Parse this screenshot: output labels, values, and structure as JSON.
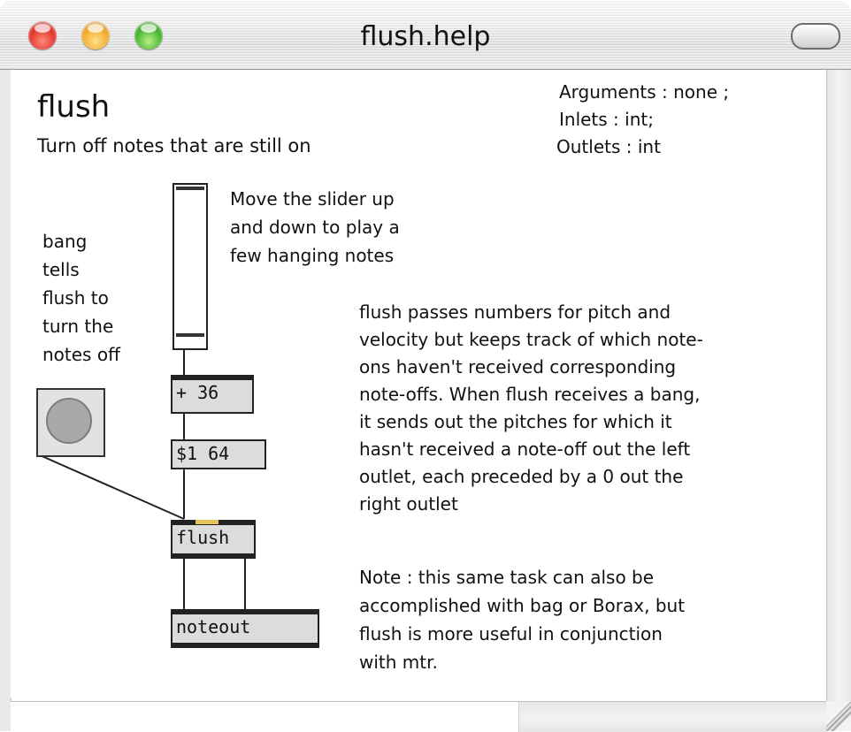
{
  "window": {
    "title": "flush.help"
  },
  "patch": {
    "title": "flush",
    "subtitle": "Turn off notes that are still on",
    "meta": {
      "arguments": "Arguments : none ;",
      "inlets": "Inlets : int;",
      "outlets": "Outlets : int"
    },
    "slider_comment": [
      "Move the slider up",
      "and down to play a",
      "few hanging notes"
    ],
    "bang_comment": [
      "bang",
      "tells",
      "flush to",
      "turn the",
      "notes off"
    ],
    "description": [
      "flush passes numbers for pitch and",
      "velocity but keeps track of which note-",
      "ons haven't received corresponding",
      "note-offs. When flush receives a bang,",
      "it sends out the pitches for which it",
      "hasn't received a note-off out the left",
      "outlet, each preceded by a 0 out the",
      "right outlet"
    ],
    "note": [
      "Note : this same task can also be",
      "accomplished with bag or Borax, but",
      "flush is more useful in conjunction",
      "with mtr."
    ],
    "objects": {
      "add": "+ 36",
      "message": "$1 64",
      "flush": "flush",
      "noteout": "noteout"
    },
    "slider_value": 0.04
  },
  "colors": {
    "close": "#e0332a",
    "minimize": "#f0a82a",
    "maximize": "#44b32c",
    "hot_inlet": "#e6c25a"
  }
}
